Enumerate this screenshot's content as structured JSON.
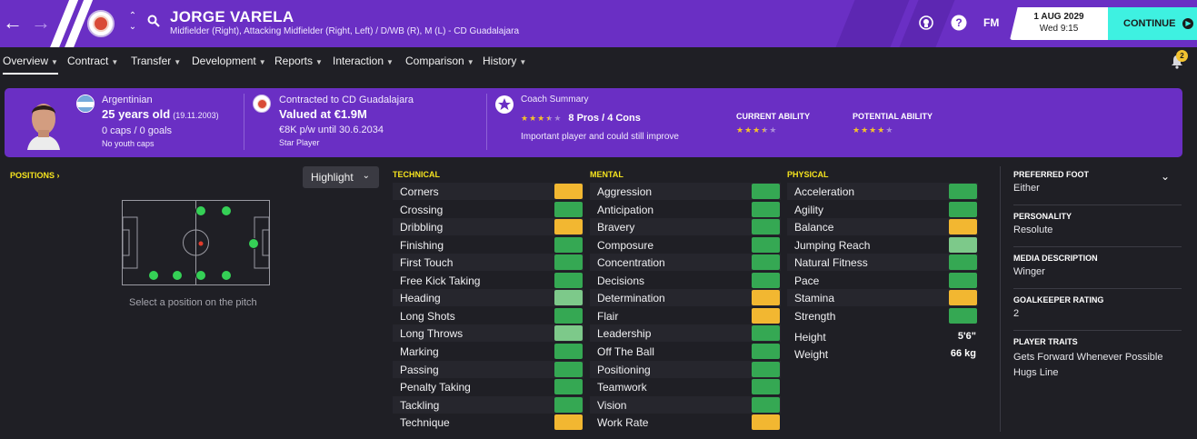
{
  "colors": {
    "brand": "#6a2fc4",
    "accent": "#3ef1e1",
    "attr_strong": "#35a853",
    "attr_very_strong": "#7dc98a",
    "attr_medium": "#f2b731",
    "section_title": "#f6e41e"
  },
  "topbar": {
    "back_icon": "arrow-left-icon",
    "forward_icon": "arrow-right-icon",
    "player_name": "JORGE VARELA",
    "player_subtitle": "Midfielder (Right), Attacking Midfielder (Right, Left) / D/WB (R), M (L) - CD Guadalajara",
    "fm_label": "FM",
    "date": "1 AUG 2029",
    "time": "Wed 9:15",
    "continue_label": "CONTINUE"
  },
  "tabs": [
    {
      "label": "Overview"
    },
    {
      "label": "Contract"
    },
    {
      "label": "Transfer"
    },
    {
      "label": "Development"
    },
    {
      "label": "Reports"
    },
    {
      "label": "Interaction"
    },
    {
      "label": "Comparison"
    },
    {
      "label": "History"
    }
  ],
  "notifications": {
    "count": "2"
  },
  "profile": {
    "nationality": "Argentinian",
    "age": "25 years old",
    "dob": "(19.11.2003)",
    "caps": "0 caps / 0 goals",
    "youth_caps": "No youth caps",
    "contract_club": "Contracted to CD Guadalajara",
    "value": "Valued at €1.9M",
    "wage": "€8K p/w until 30.6.2034",
    "status": "Star Player",
    "coach_title": "Coach Summary",
    "coach_stars": 3.5,
    "coach_pros_cons": "8 Pros / 4 Cons",
    "coach_note": "Important player and could still improve",
    "current_ability_label": "CURRENT ABILITY",
    "current_ability_stars": 3.5,
    "potential_ability_label": "POTENTIAL ABILITY",
    "potential_ability_stars": 4
  },
  "positions": {
    "title": "POSITIONS",
    "highlight_label": "Highlight",
    "caption": "Select a position on the pitch"
  },
  "technical": {
    "title": "TECHNICAL",
    "attributes": [
      {
        "name": "Corners",
        "level": "medium"
      },
      {
        "name": "Crossing",
        "level": "strong"
      },
      {
        "name": "Dribbling",
        "level": "medium"
      },
      {
        "name": "Finishing",
        "level": "strong"
      },
      {
        "name": "First Touch",
        "level": "strong"
      },
      {
        "name": "Free Kick Taking",
        "level": "strong"
      },
      {
        "name": "Heading",
        "level": "very_strong"
      },
      {
        "name": "Long Shots",
        "level": "strong"
      },
      {
        "name": "Long Throws",
        "level": "very_strong"
      },
      {
        "name": "Marking",
        "level": "strong"
      },
      {
        "name": "Passing",
        "level": "strong"
      },
      {
        "name": "Penalty Taking",
        "level": "strong"
      },
      {
        "name": "Tackling",
        "level": "strong"
      },
      {
        "name": "Technique",
        "level": "medium"
      }
    ]
  },
  "mental": {
    "title": "MENTAL",
    "attributes": [
      {
        "name": "Aggression",
        "level": "strong"
      },
      {
        "name": "Anticipation",
        "level": "strong"
      },
      {
        "name": "Bravery",
        "level": "strong"
      },
      {
        "name": "Composure",
        "level": "strong"
      },
      {
        "name": "Concentration",
        "level": "strong"
      },
      {
        "name": "Decisions",
        "level": "strong"
      },
      {
        "name": "Determination",
        "level": "medium"
      },
      {
        "name": "Flair",
        "level": "medium"
      },
      {
        "name": "Leadership",
        "level": "strong"
      },
      {
        "name": "Off The Ball",
        "level": "strong"
      },
      {
        "name": "Positioning",
        "level": "strong"
      },
      {
        "name": "Teamwork",
        "level": "strong"
      },
      {
        "name": "Vision",
        "level": "strong"
      },
      {
        "name": "Work Rate",
        "level": "medium"
      }
    ]
  },
  "physical": {
    "title": "PHYSICAL",
    "attributes": [
      {
        "name": "Acceleration",
        "level": "strong"
      },
      {
        "name": "Agility",
        "level": "strong"
      },
      {
        "name": "Balance",
        "level": "medium"
      },
      {
        "name": "Jumping Reach",
        "level": "very_strong"
      },
      {
        "name": "Natural Fitness",
        "level": "strong"
      },
      {
        "name": "Pace",
        "level": "strong"
      },
      {
        "name": "Stamina",
        "level": "medium"
      },
      {
        "name": "Strength",
        "level": "strong"
      }
    ],
    "height_label": "Height",
    "height_value": "5'6\"",
    "weight_label": "Weight",
    "weight_value": "66 kg"
  },
  "sidebar": {
    "preferred_foot_title": "PREFERRED FOOT",
    "preferred_foot_value": "Either",
    "personality_title": "PERSONALITY",
    "personality_value": "Resolute",
    "media_title": "MEDIA DESCRIPTION",
    "media_value": "Winger",
    "gk_title": "GOALKEEPER RATING",
    "gk_value": "2",
    "traits_title": "PLAYER TRAITS",
    "traits": [
      "Gets Forward Whenever Possible",
      "Hugs Line"
    ]
  }
}
